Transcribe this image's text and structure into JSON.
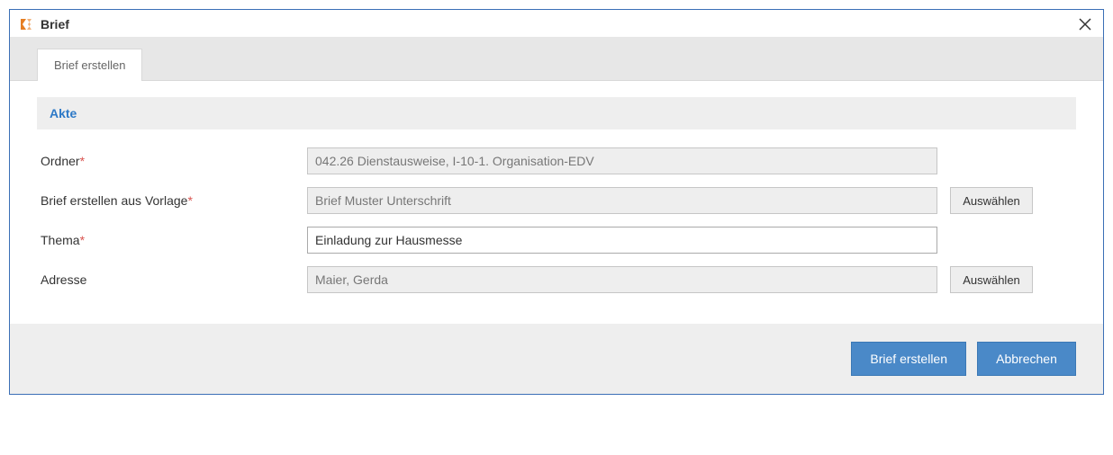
{
  "window": {
    "title": "Brief"
  },
  "tabs": {
    "create": "Brief erstellen"
  },
  "section": {
    "title": "Akte"
  },
  "form": {
    "folder": {
      "label": "Ordner",
      "value": "042.26 Dienstausweise, I-10-1. Organisation-EDV"
    },
    "template": {
      "label": "Brief erstellen aus Vorlage",
      "value": "Brief Muster Unterschrift",
      "select_label": "Auswählen"
    },
    "topic": {
      "label": "Thema",
      "value": "Einladung zur Hausmesse"
    },
    "address": {
      "label": "Adresse",
      "value": "Maier, Gerda",
      "select_label": "Auswählen"
    }
  },
  "actions": {
    "create": "Brief erstellen",
    "cancel": "Abbrechen"
  }
}
